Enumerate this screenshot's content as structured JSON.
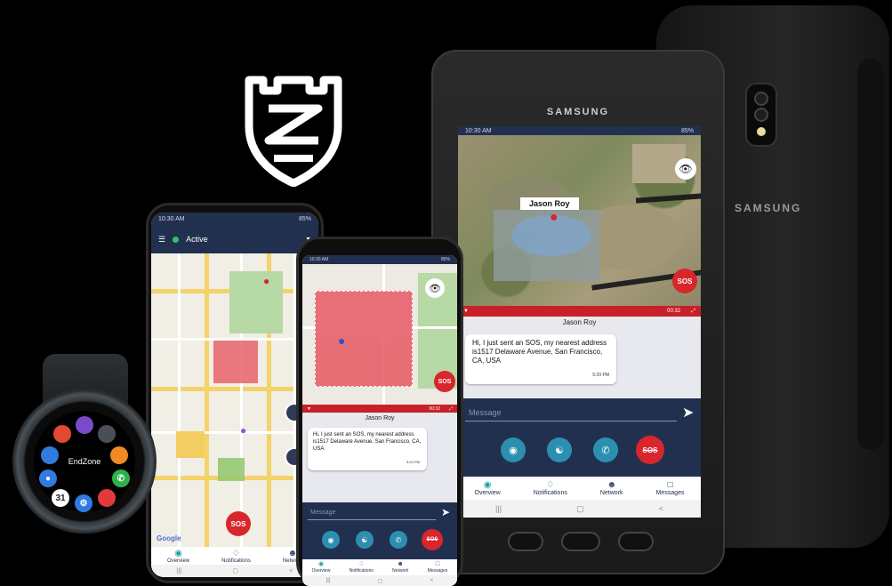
{
  "brand": {
    "device_brand": "SAMSUNG",
    "shield_icon": "knox-shield-icon"
  },
  "colors": {
    "navy": "#22304f",
    "sos_red": "#d8262c",
    "teal": "#19a1a0",
    "zone_red": "#e8616b"
  },
  "nav_items": [
    {
      "label": "Overview",
      "icon": "location-pin-icon"
    },
    {
      "label": "Notifications",
      "icon": "bell-icon"
    },
    {
      "label": "Network",
      "icon": "person-icon"
    },
    {
      "label": "Messages",
      "icon": "chat-bubble-icon"
    }
  ],
  "tablet": {
    "status_time": "10:30 AM",
    "status_right": "85%",
    "map_person_label": "Jason Roy",
    "sos_label": "SOS",
    "timer": "00:32",
    "contact_name": "Jason Roy",
    "message_text": "Hi, I just sent an SOS, my nearest address is1517  Delaware Avenue, San Francisco, CA, USA",
    "message_time": "5:20 PM",
    "message_placeholder": "Message"
  },
  "phone_left": {
    "status_time": "10:30 AM",
    "status_right": "85%",
    "status_label": "Active",
    "sos_label": "SOS",
    "map_attribution": "Google"
  },
  "phone_mid": {
    "status_time": "10:30 AM",
    "status_right": "85%",
    "sos_label": "SOS",
    "timer": "00:32",
    "contact_name": "Jason Roy",
    "message_text": "Hi, I just sent an SOS, my nearest address is1517  Delaware Avenue, San Francisco, CA, USA",
    "message_time": "5:20 PM",
    "message_placeholder": "Message"
  },
  "watch": {
    "center_label": "EndZone",
    "calendar_day": "31"
  }
}
